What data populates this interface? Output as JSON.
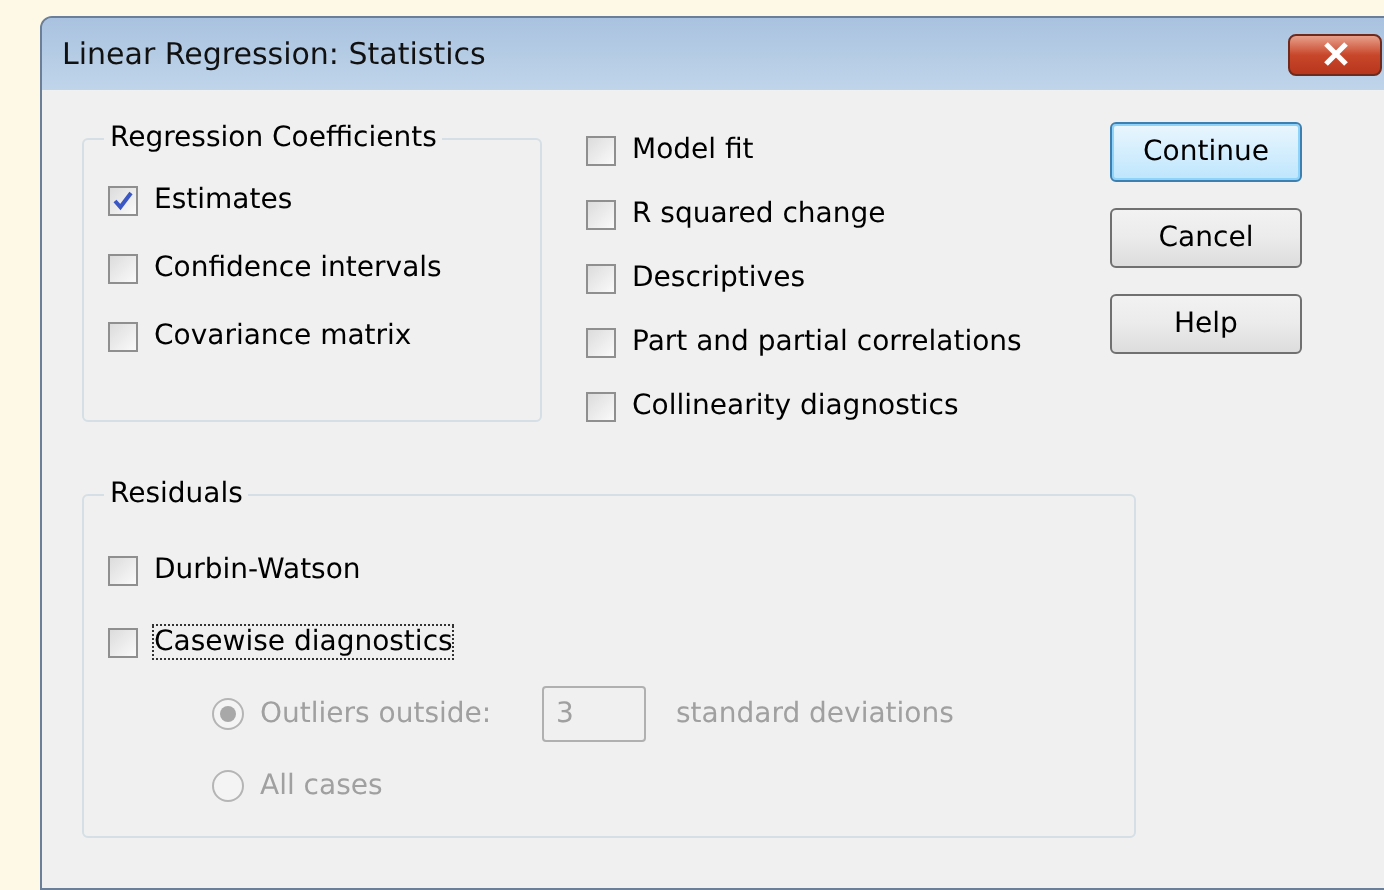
{
  "window": {
    "title": "Linear Regression: Statistics"
  },
  "coefficients": {
    "title": "Regression Coefficients",
    "options": [
      {
        "label": "Estimates",
        "checked": true
      },
      {
        "label": "Confidence intervals",
        "checked": false
      },
      {
        "label": "Covariance matrix",
        "checked": false
      }
    ]
  },
  "model_options": [
    {
      "label": "Model fit",
      "checked": false
    },
    {
      "label": "R squared change",
      "checked": false
    },
    {
      "label": "Descriptives",
      "checked": false
    },
    {
      "label": "Part and partial correlations",
      "checked": false
    },
    {
      "label": "Collinearity diagnostics",
      "checked": false
    }
  ],
  "buttons": [
    {
      "label": "Continue",
      "default": true
    },
    {
      "label": "Cancel",
      "default": false
    },
    {
      "label": "Help",
      "default": false
    }
  ],
  "residuals": {
    "title": "Residuals",
    "options": [
      {
        "label": "Durbin-Watson",
        "checked": false,
        "focused": false
      },
      {
        "label": "Casewise diagnostics",
        "checked": false,
        "focused": true
      }
    ],
    "casewise": {
      "disabled": true,
      "choices": [
        {
          "label": "Outliers outside:",
          "selected": true
        },
        {
          "label": "All cases",
          "selected": false
        }
      ],
      "value": "3",
      "unit": "standard deviations"
    }
  }
}
